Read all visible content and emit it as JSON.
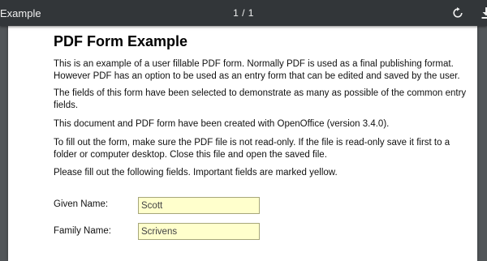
{
  "toolbar": {
    "title": "Example",
    "page_counter": "1 / 1",
    "rotate_icon": "rotate-icon",
    "download_icon": "download-icon"
  },
  "document": {
    "heading": "PDF Form Example",
    "paragraphs": [
      "This is an example of a user fillable PDF form. Normally PDF is used as a final publishing format. However PDF has an option to be used as an entry form that can be edited and saved by the user.",
      "The fields of this form have been selected to demonstrate as many as possible of the common entry fields.",
      "This document and PDF form have been created with OpenOffice (version 3.4.0).",
      "To fill out the form, make sure the PDF file is not read-only. If the file is read-only save it first to a folder or computer desktop. Close this file and open the saved file.",
      "Please fill out the following fields. Important fields are marked yellow."
    ],
    "fields": {
      "given_name": {
        "label": "Given Name:",
        "value": "Scott",
        "color": "#ffffcc"
      },
      "family_name": {
        "label": "Family Name:",
        "value": "Scrivens",
        "color": "#ffffcc"
      }
    }
  }
}
